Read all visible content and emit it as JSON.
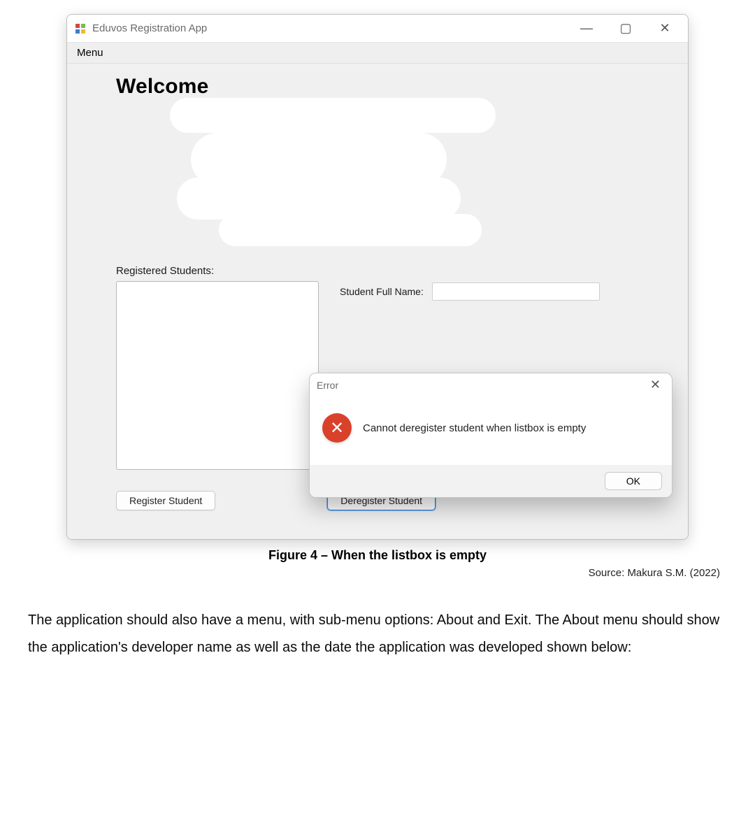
{
  "window": {
    "title": "Eduvos Registration App",
    "menu_label": "Menu",
    "welcome": "Welcome",
    "registered_label": "Registered Students:",
    "fullname_label": "Student Full Name:",
    "register_btn": "Register Student",
    "deregister_btn": "Deregister Student",
    "win_min": "—",
    "win_max": "▢",
    "win_close": "✕"
  },
  "dialog": {
    "title": "Error",
    "message": "Cannot deregister student when listbox is empty",
    "ok": "OK",
    "close": "✕",
    "icon_glyph": "✕"
  },
  "caption": "Figure 4 – When the listbox is empty",
  "source": "Source: Makura S.M. (2022)",
  "paragraph": "The application should also have a menu, with sub-menu options: About and Exit. The About menu should show the application's developer name as well as the date the application was developed shown below:"
}
